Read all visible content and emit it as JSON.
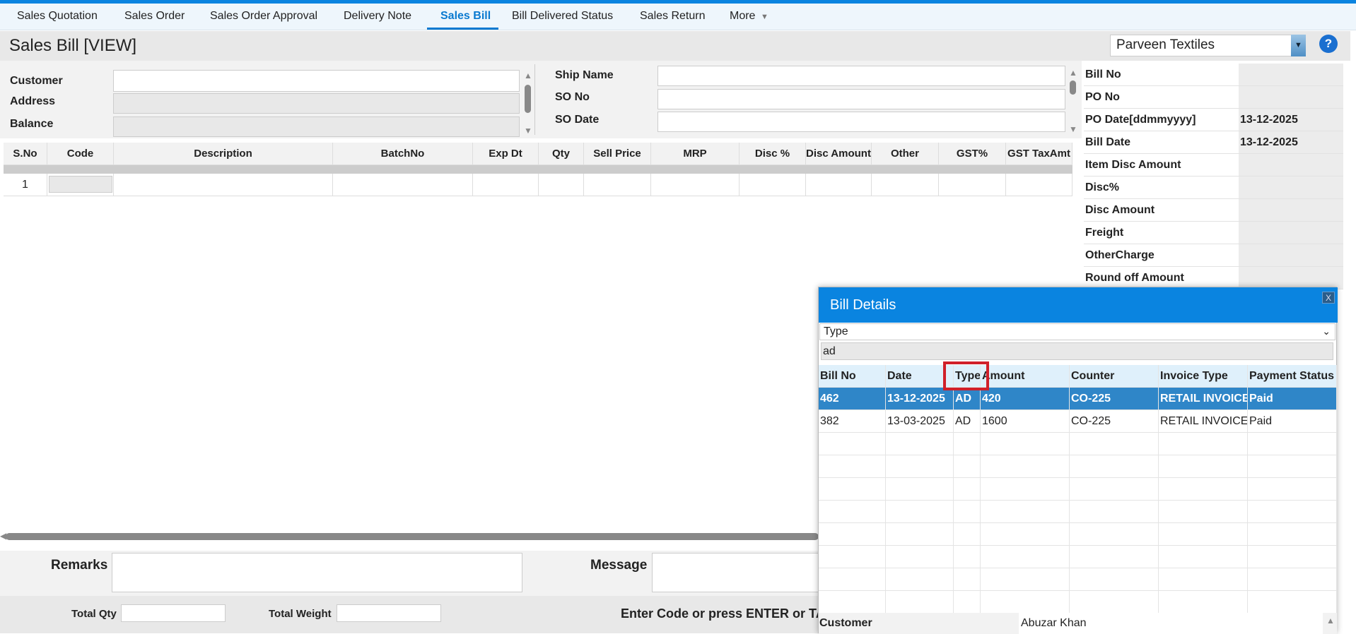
{
  "tabs": [
    "Sales Quotation",
    "Sales Order",
    "Sales Order Approval",
    "Delivery Note",
    "Sales Bill",
    "Bill Delivered Status",
    "Sales Return",
    "More"
  ],
  "active_tab": "Sales Bill",
  "page_title": "Sales Bill [VIEW]",
  "company": "Parveen Textiles",
  "help_label": "?",
  "form": {
    "customer_label": "Customer",
    "address_label": "Address",
    "balance_label": "Balance",
    "ship_name_label": "Ship Name",
    "so_no_label": "SO No",
    "so_date_label": "SO Date"
  },
  "summary": [
    {
      "label": "Bill No",
      "value": ""
    },
    {
      "label": "PO No",
      "value": ""
    },
    {
      "label": "PO Date[ddmmyyyy]",
      "value": "13-12-2025"
    },
    {
      "label": "Bill Date",
      "value": "13-12-2025"
    },
    {
      "label": "Item Disc Amount",
      "value": ""
    },
    {
      "label": "Disc%",
      "value": ""
    },
    {
      "label": "Disc Amount",
      "value": ""
    },
    {
      "label": "Freight",
      "value": ""
    },
    {
      "label": "OtherCharge",
      "value": ""
    },
    {
      "label": "Round off Amount",
      "value": ""
    }
  ],
  "grid": {
    "columns": [
      "S.No",
      "Code",
      "Description",
      "BatchNo",
      "Exp Dt",
      "Qty",
      "Sell Price",
      "MRP",
      "Disc %",
      "Disc Amount",
      "Other",
      "GST%",
      "GST TaxAmt"
    ],
    "rows": [
      [
        "1"
      ]
    ]
  },
  "remarks_label": "Remarks",
  "message_label": "Message",
  "total_qty_label": "Total Qty",
  "total_weight_label": "Total Weight",
  "hint": "Enter Code or press ENTER or TAB",
  "dialog": {
    "title": "Bill Details",
    "close_label": "X",
    "filter_field": "Type",
    "search_value": "ad",
    "columns": [
      "Bill No",
      "Date",
      "Type",
      "Amount",
      "Counter",
      "Invoice Type",
      "Payment Status"
    ],
    "rows": [
      [
        "462",
        "13-12-2025",
        "AD",
        "420",
        "CO-225",
        "RETAIL INVOICE",
        "Paid"
      ],
      [
        "382",
        "13-03-2025",
        "AD",
        "1600",
        "CO-225",
        "RETAIL INVOICE",
        "Paid"
      ]
    ],
    "customer_label": "Customer",
    "customer_value": "Abuzar Khan"
  },
  "colors": {
    "accent": "#0a84e0",
    "selected_row": "#2f86c8",
    "highlight_box": "#d0202a"
  }
}
